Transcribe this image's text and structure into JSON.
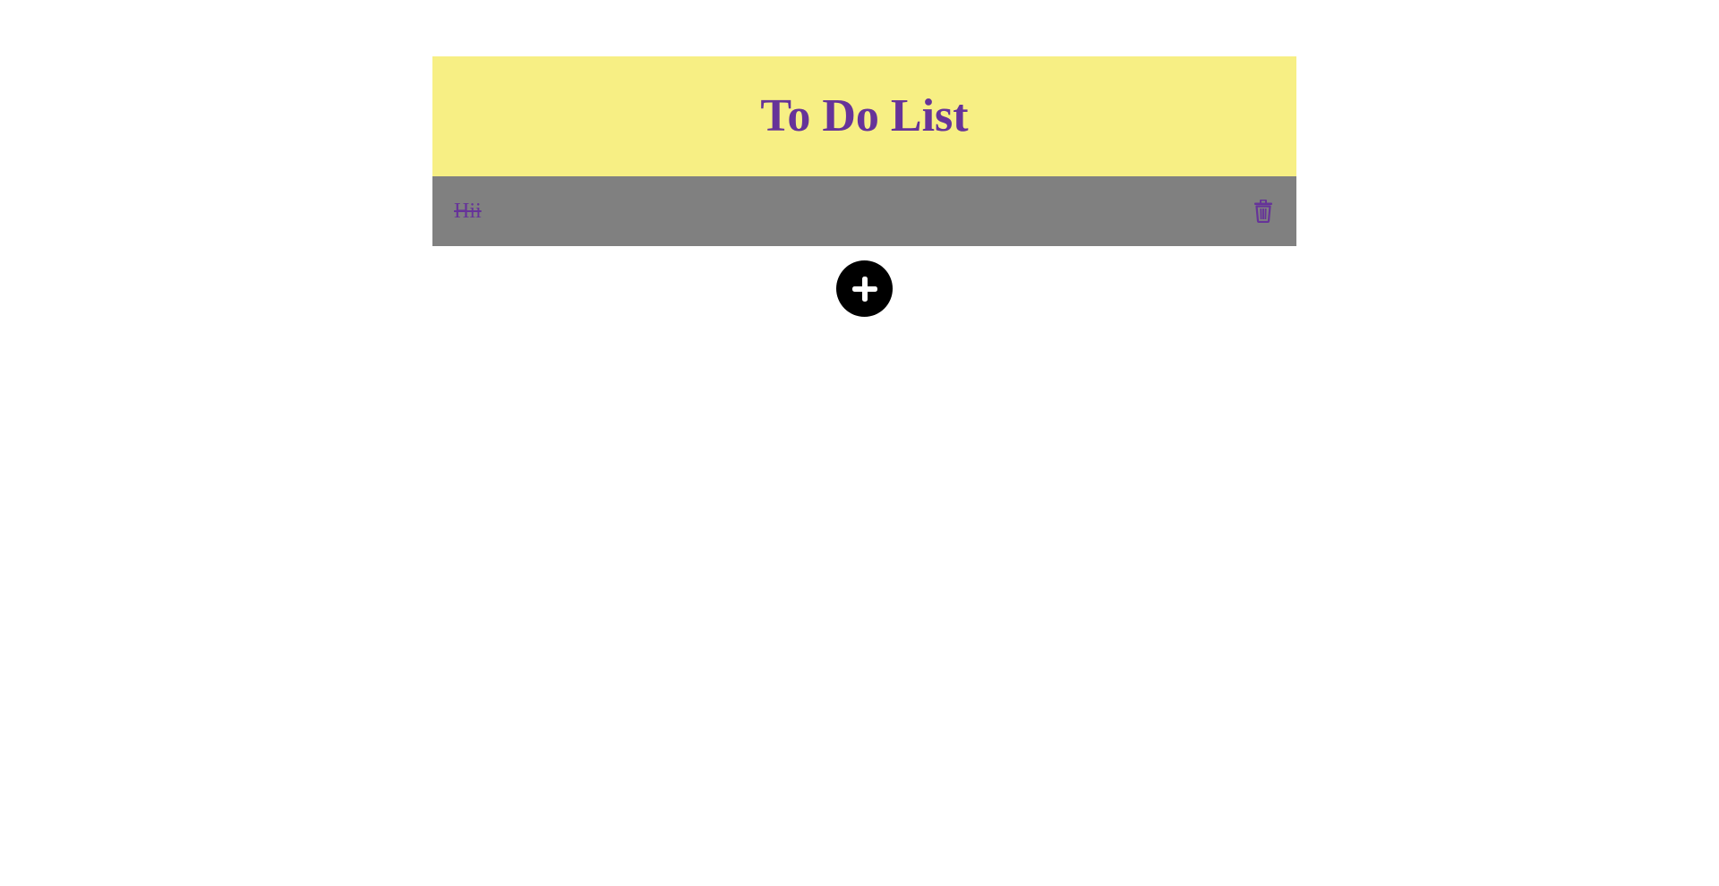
{
  "header": {
    "title": "To Do List"
  },
  "todos": [
    {
      "text": "Hii",
      "completed": true
    }
  ],
  "icons": {
    "delete": "trash-icon",
    "add": "plus-icon"
  },
  "colors": {
    "header_bg": "#f7ef84",
    "title": "#663399",
    "item_bg": "#808080",
    "item_text": "#663399",
    "add_button_bg": "#000000"
  }
}
